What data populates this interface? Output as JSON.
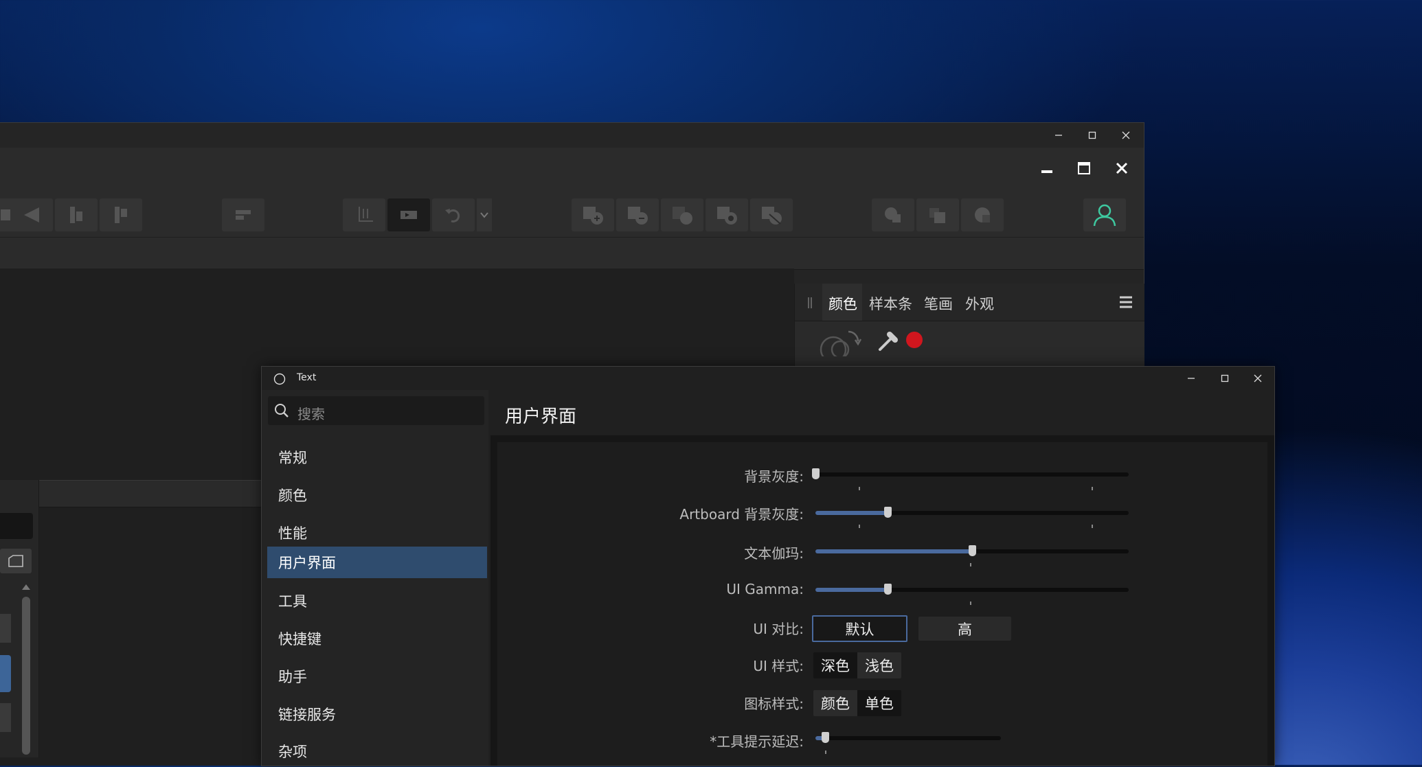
{
  "app": {
    "panel_tabs": [
      "颜色",
      "样本条",
      "笔画",
      "外观"
    ]
  },
  "dialog": {
    "title": "Text",
    "search_placeholder": "搜索",
    "nav": [
      "常规",
      "颜色",
      "性能",
      "用户界面",
      "工具",
      "快捷键",
      "助手",
      "链接服务",
      "杂项"
    ],
    "selected_nav": "用户界面",
    "heading": "用户界面",
    "settings": {
      "background_gray": {
        "label": "背景灰度:",
        "value": 0.0
      },
      "artboard_gray": {
        "label": "Artboard 背景灰度:",
        "value": 0.23
      },
      "text_gamma": {
        "label": "文本伽玛:",
        "value": 0.5
      },
      "ui_gamma": {
        "label": "UI Gamma:",
        "value": 0.23
      },
      "ui_contrast": {
        "label": "UI 对比:",
        "options": [
          "默认",
          "高"
        ],
        "selected": "默认"
      },
      "ui_style": {
        "label": "UI 样式:",
        "options": [
          "深色",
          "浅色"
        ],
        "selected": "深色"
      },
      "icon_style": {
        "label": "图标样式:",
        "options": [
          "颜色",
          "单色"
        ],
        "selected": "颜色"
      },
      "tooltip_delay": {
        "label": "*工具提示延迟:",
        "value": 0.05
      }
    }
  },
  "colors": {
    "accent": "#2f4c6e",
    "slider_fill": "#4a6a9e",
    "user_icon": "#3ec9a0",
    "record": "#d0161e"
  }
}
